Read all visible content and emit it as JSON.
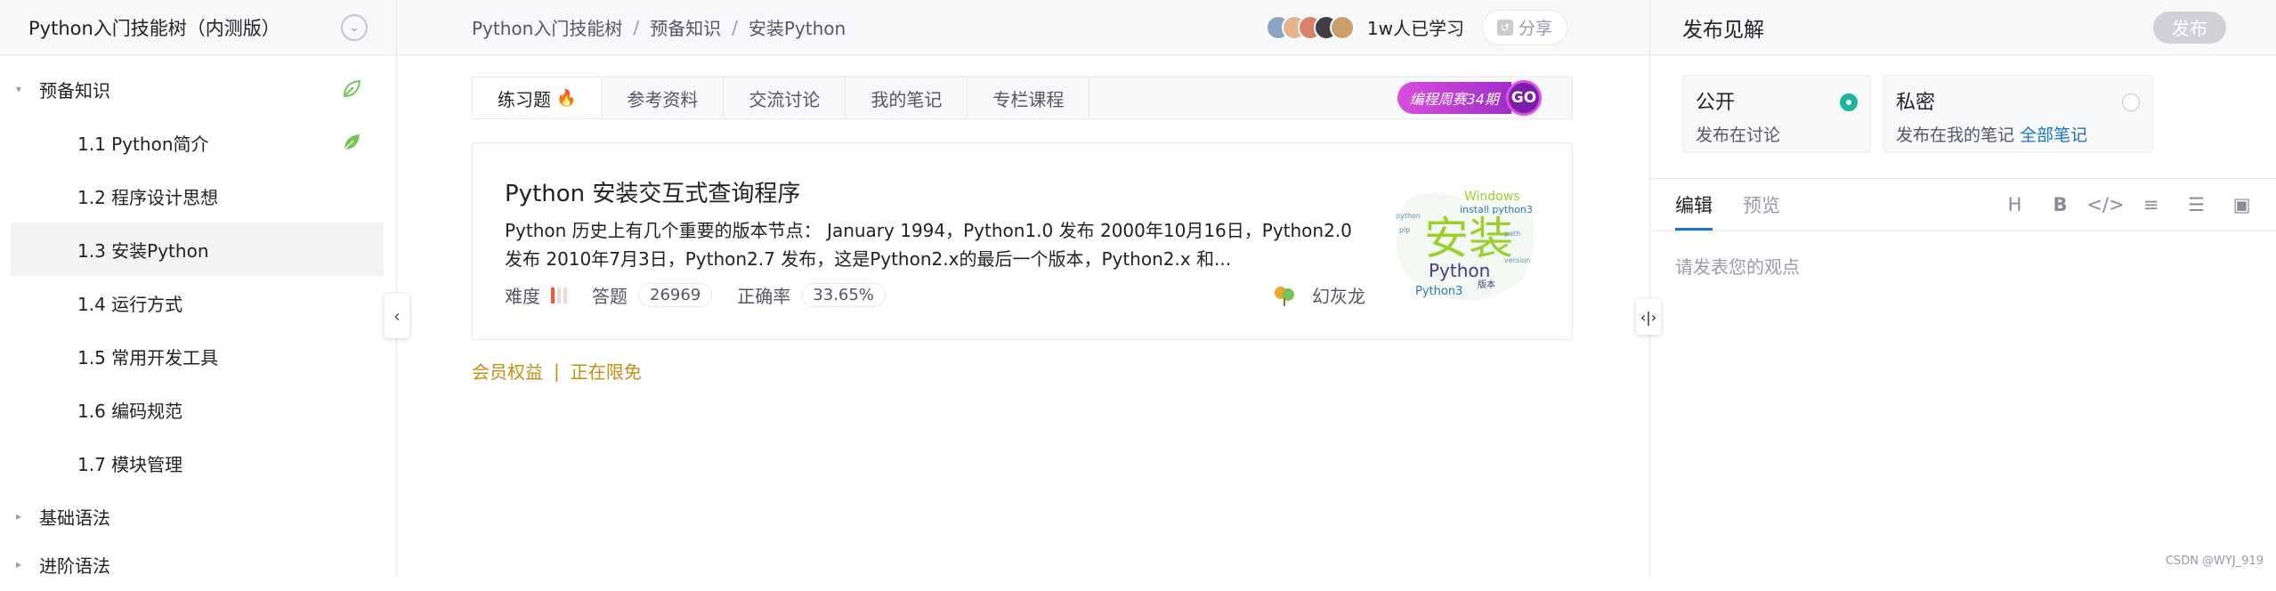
{
  "sidebar": {
    "title": "Python入门技能树（内测版）",
    "groups": [
      {
        "label": "预备知识",
        "expanded": true
      },
      {
        "label": "基础语法",
        "expanded": false
      },
      {
        "label": "进阶语法",
        "expanded": false
      }
    ],
    "items": [
      {
        "label": "1.1 Python简介",
        "leaf_done": true
      },
      {
        "label": "1.2 程序设计思想"
      },
      {
        "label": "1.3 安装Python",
        "active": true
      },
      {
        "label": "1.4 运行方式"
      },
      {
        "label": "1.5 常用开发工具"
      },
      {
        "label": "1.6 编码规范"
      },
      {
        "label": "1.7 模块管理"
      }
    ]
  },
  "topbar": {
    "breadcrumb": [
      "Python入门技能树",
      "预备知识",
      "安装Python"
    ],
    "learners": "1w人已学习",
    "share_label": "分享"
  },
  "tabs": [
    {
      "label": "练习题",
      "active": true
    },
    {
      "label": "参考资料"
    },
    {
      "label": "交流讨论"
    },
    {
      "label": "我的笔记"
    },
    {
      "label": "专栏课程"
    }
  ],
  "promo": {
    "label": "编程周赛34期",
    "go": "GO"
  },
  "card": {
    "title": "Python 安装交互式查询程序",
    "description": "Python 历史上有几个重要的版本节点： January 1994，Python1.0 发布 2000年10月16日，Python2.0 发布 2010年7月3日，Python2.7 发布，这是Python2.x的最后一个版本，Python2.x 和...",
    "difficulty_label": "难度",
    "difficulty_level": 1,
    "difficulty_max": 3,
    "answers_label": "答题",
    "answers": "26969",
    "accuracy_label": "正确率",
    "accuracy": "33.65%",
    "author": "幻灰龙",
    "wordcloud": {
      "main": "安装",
      "words": [
        "Windows",
        "install python3",
        "Python",
        "Python3",
        "版本"
      ]
    }
  },
  "member": {
    "benefit": "会员权益",
    "separator": "|",
    "free": "正在限免"
  },
  "right_panel": {
    "title": "发布见解",
    "publish_label": "发布",
    "visibility": [
      {
        "title": "公开",
        "subtitle": "发布在讨论",
        "selected": true
      },
      {
        "title": "私密",
        "subtitle": "发布在我的笔记",
        "link": "全部笔记",
        "selected": false
      }
    ],
    "editor_tabs": [
      {
        "label": "编辑",
        "active": true
      },
      {
        "label": "预览"
      }
    ],
    "toolbar": [
      "heading-icon",
      "bold-icon",
      "code-icon",
      "bullet-list-icon",
      "numbered-list-icon",
      "image-icon"
    ],
    "placeholder": "请发表您的观点"
  },
  "watermark": "CSDN @WYJ_919",
  "colors": {
    "accent": "#1a73c9",
    "link_gold": "#c78d12",
    "radio_on": "#1fb59d",
    "flame": "#fc5531",
    "leaf": "#7ac35a"
  }
}
